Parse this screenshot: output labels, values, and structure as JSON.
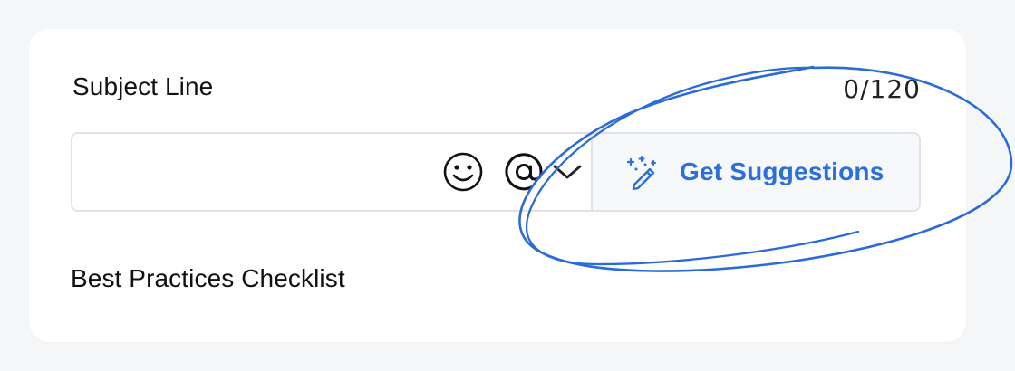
{
  "form": {
    "subject_label": "Subject Line",
    "char_counter": "0/120",
    "subject_value": "",
    "subject_placeholder": "",
    "suggest_label": "Get Suggestions",
    "checklist_label": "Best Practices Checklist"
  },
  "icons": {
    "emoji": "smiley-face-icon",
    "mention": "at-sign-icon",
    "dropdown": "chevron-down-icon",
    "suggest": "magic-wand-icon"
  },
  "colors": {
    "accent": "#2b70d9",
    "annotation": "#2a6bd8",
    "border": "#dfe2e7",
    "button_bg": "#f7f8fa"
  }
}
